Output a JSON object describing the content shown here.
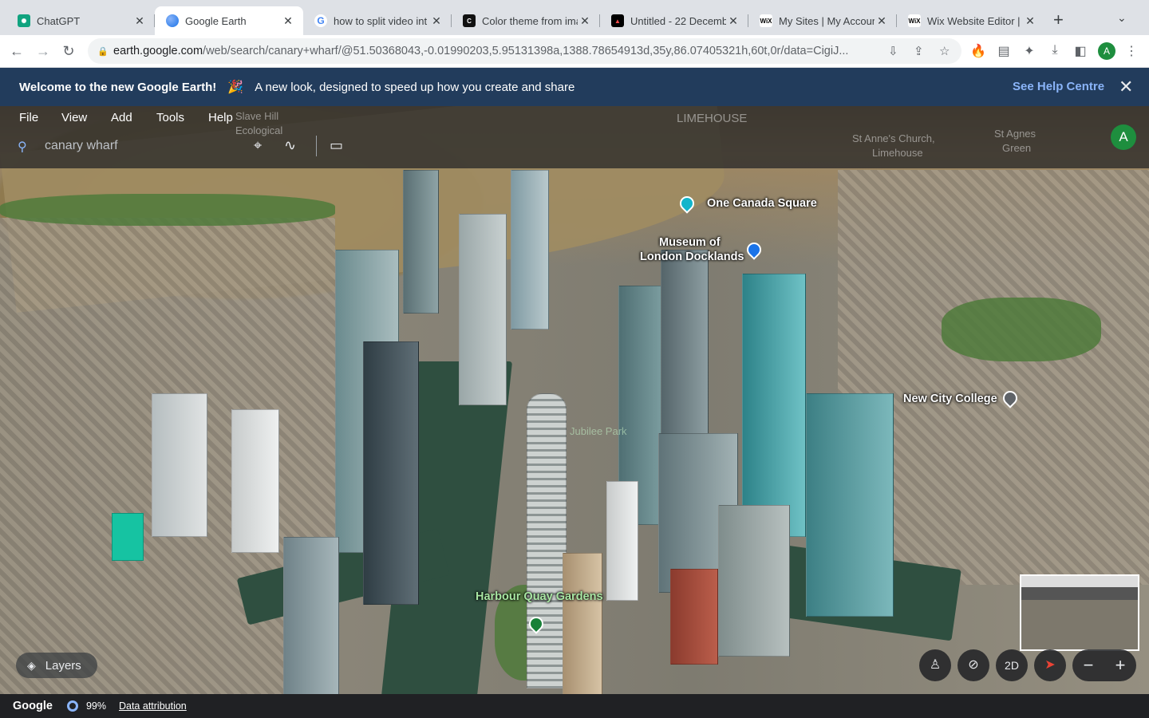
{
  "browser": {
    "tabs": [
      {
        "title": "ChatGPT",
        "icon": "chatgpt-icon",
        "active": false
      },
      {
        "title": "Google Earth",
        "icon": "google-earth-icon",
        "active": true
      },
      {
        "title": "how to split video int",
        "icon": "google-icon",
        "active": false
      },
      {
        "title": "Color theme from ima",
        "icon": "color-theme-icon",
        "active": false
      },
      {
        "title": "Untitled - 22 Decemb",
        "icon": "adobe-express-icon",
        "active": false
      },
      {
        "title": "My Sites | My Accoun",
        "icon": "wix-icon",
        "active": false
      },
      {
        "title": "Wix Website Editor |",
        "icon": "wix-icon",
        "active": false
      }
    ],
    "url_host": "earth.google.com",
    "url_path": "/web/search/canary+wharf/@51.50368043,-0.01990203,5.95131398a,1388.78654913d,35y,86.07405321h,60t,0r/data=CigiJ...",
    "profile_initial": "A"
  },
  "banner": {
    "title": "Welcome to the new Google Earth!",
    "emoji": "🎉",
    "message": "A new look, designed to speed up how you create and share",
    "help_link": "See Help Centre"
  },
  "menu": {
    "items": [
      "File",
      "View",
      "Add",
      "Tools",
      "Help"
    ]
  },
  "search": {
    "value": "canary wharf"
  },
  "account": {
    "initial": "A"
  },
  "map_labels": {
    "one_canada_square": "One Canada Square",
    "museum": "Museum of\nLondon Docklands",
    "museum_line1": "Museum of",
    "museum_line2": "London Docklands",
    "new_city_college": "New City College",
    "harbour_quay": "Harbour Quay Gardens",
    "limehouse": "LIMEHOUSE",
    "st_annes": "St Anne's Church,",
    "st_annes2": "Limehouse",
    "st_agnes": "St Agnes",
    "st_agnes2": "Green",
    "slave_hill": "Slave Hill",
    "ecological": "Ecological",
    "jubilee_park": "Jubilee Park"
  },
  "controls": {
    "layers_label": "Layers",
    "mode_2d": "2D"
  },
  "footer": {
    "logo": "Google",
    "loaded_pct": "99%",
    "attribution": "Data attribution"
  },
  "colors": {
    "banner_bg": "#223c5c",
    "help_link": "#8ab4f8",
    "account": "#1e8e3e"
  }
}
